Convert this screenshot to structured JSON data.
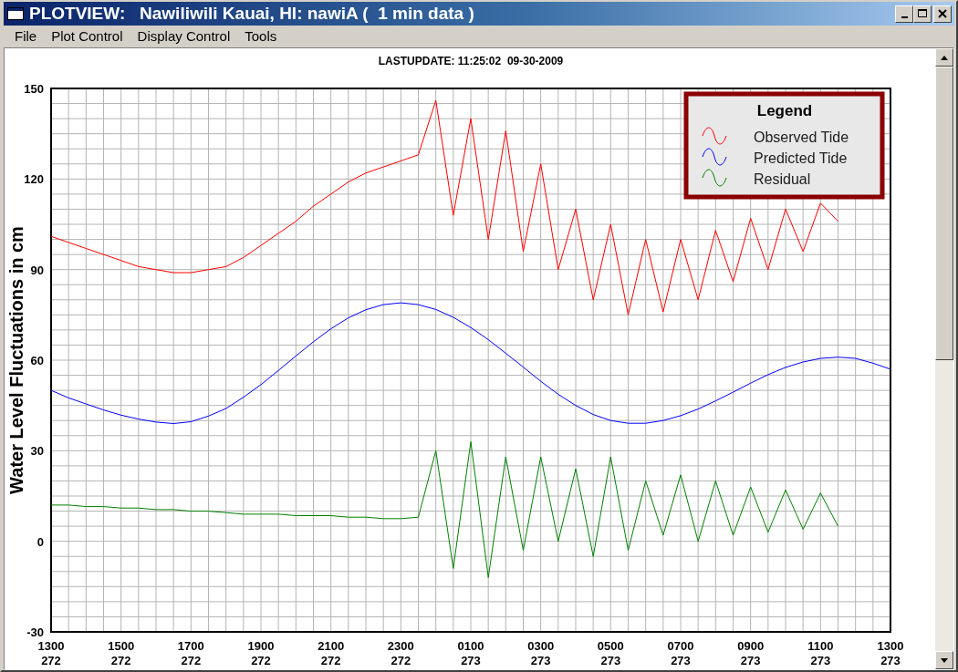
{
  "window": {
    "title": "PLOTVIEW:   Nawiliwili Kauai, HI: nawiA (  1 min data )"
  },
  "menu": [
    "File",
    "Plot Control",
    "Display Control",
    "Tools"
  ],
  "chart": {
    "chart_data": {
      "type": "line",
      "title": "LASTUPDATE: 11:25:02  09-30-2009",
      "ylabel": "Water Level Fluctuations in cm",
      "categories": [
        "1300 272",
        null,
        null,
        null,
        "1500 272",
        null,
        null,
        null,
        "1700 272",
        null,
        null,
        null,
        "1900 272",
        null,
        null,
        null,
        "2100 272",
        null,
        null,
        null,
        "2300 272",
        null,
        null,
        null,
        "0100 273",
        null,
        null,
        null,
        "0300 273",
        null,
        null,
        null,
        "0500 273",
        null,
        null,
        null,
        "0700 273",
        null,
        null,
        null,
        "0900 273",
        null,
        null,
        null,
        "1100 273",
        null,
        null,
        null,
        "1300 273"
      ],
      "ylim": [
        -30,
        150
      ],
      "grid": true,
      "legend": {
        "title": "Legend"
      },
      "yticks": [
        150,
        120,
        90,
        60,
        30,
        0,
        -30
      ],
      "series": [
        {
          "name": "Observed Tide",
          "color": "#ff0000",
          "values": [
            101,
            99,
            97,
            95,
            93,
            91,
            90,
            89,
            89,
            90,
            91,
            94,
            98,
            102,
            106,
            111,
            115,
            119,
            122,
            124,
            126,
            128,
            146,
            108,
            140,
            100,
            136,
            96,
            125,
            90,
            110,
            80,
            105,
            75,
            100,
            76,
            100,
            80,
            103,
            86,
            107,
            90,
            110,
            96,
            112,
            106,
            null,
            null,
            null
          ]
        },
        {
          "name": "Predicted Tide",
          "color": "#0000ff",
          "values": [
            50,
            47.5,
            45.5,
            43.5,
            41.8,
            40.5,
            39.5,
            39,
            39.6,
            41.5,
            44,
            47.7,
            51.9,
            56.6,
            61.4,
            66.1,
            70.4,
            74,
            76.7,
            78.4,
            79,
            78.4,
            76.8,
            74.2,
            70.8,
            66.8,
            62.3,
            57.7,
            53,
            48.7,
            45,
            42,
            40,
            39.1,
            39.1,
            40,
            41.6,
            43.8,
            46.5,
            49.4,
            52.4,
            55.2,
            57.6,
            59.4,
            60.6,
            61,
            60.6,
            59,
            57
          ]
        },
        {
          "name": "Residual",
          "color": "#008000",
          "values": [
            12,
            12,
            11.5,
            11.5,
            11,
            11,
            10.5,
            10.5,
            10,
            10,
            9.5,
            9,
            9,
            9,
            8.5,
            8.5,
            8.5,
            8,
            8,
            7.5,
            7.5,
            8,
            30,
            -9,
            33,
            -12,
            28,
            -3,
            28,
            0,
            24,
            -5,
            28,
            -3,
            20,
            2,
            22,
            0,
            20,
            2,
            18,
            3,
            17,
            4,
            16,
            5,
            null,
            null,
            null
          ]
        }
      ]
    }
  }
}
